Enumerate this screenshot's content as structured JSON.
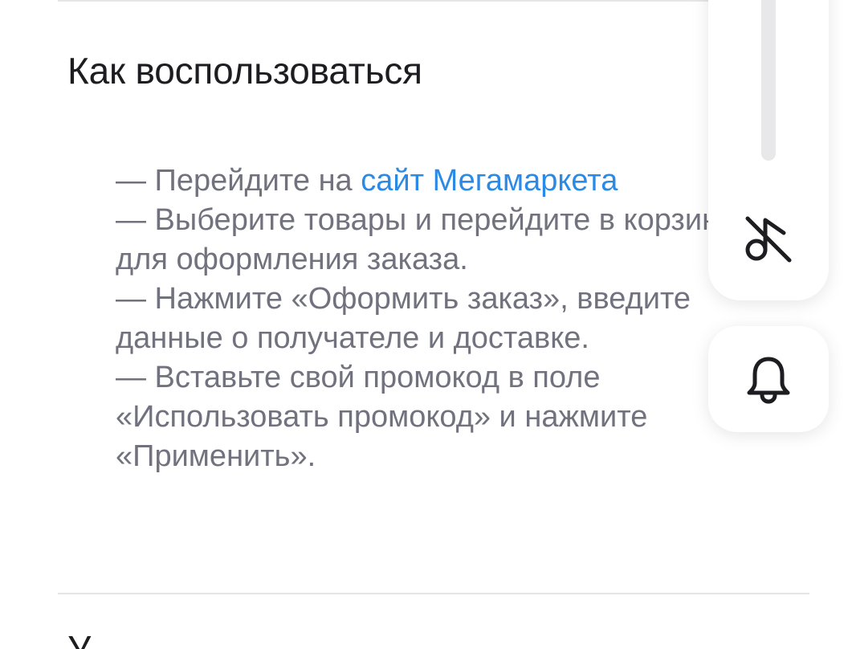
{
  "section": {
    "title": "Как воспользоваться"
  },
  "instructions": {
    "step1_prefix": "— Перейдите на ",
    "step1_link": "сайт Мегамаркета",
    "step2": "— Выберите товары и перейдите в корзину для оформления заказа.",
    "step3": "— Нажмите «Оформить заказ», введите данные о получателе и доставке.",
    "step4": "— Вставьте свой промокод в поле «Использовать промокод» и нажмите «Применить»."
  },
  "next_section": {
    "title_partial": "У"
  },
  "widget": {
    "sound_icon": "music-off-icon",
    "bell_icon": "bell-icon"
  },
  "colors": {
    "title": "#1d1d21",
    "body_text": "#72727e",
    "link": "#2a8ae6",
    "divider": "#e6e6e9"
  }
}
